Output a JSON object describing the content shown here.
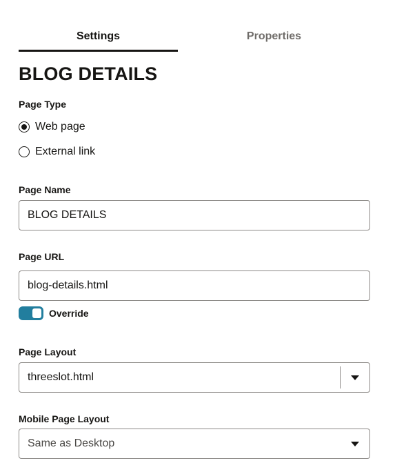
{
  "tabs": [
    {
      "label": "Settings",
      "active": true
    },
    {
      "label": "Properties",
      "active": false
    }
  ],
  "page_title": "BLOG DETAILS",
  "page_type": {
    "label": "Page Type",
    "options": [
      {
        "label": "Web page",
        "selected": true
      },
      {
        "label": "External link",
        "selected": false
      }
    ]
  },
  "page_name": {
    "label": "Page Name",
    "value": "BLOG DETAILS"
  },
  "page_url": {
    "label": "Page URL",
    "value": "blog-details.html",
    "override_label": "Override",
    "override_on": true
  },
  "page_layout": {
    "label": "Page Layout",
    "value": "threeslot.html"
  },
  "mobile_layout": {
    "label": "Mobile Page Layout",
    "value": "Same as Desktop"
  },
  "colors": {
    "toggle_on": "#227e9e",
    "text": "#161513",
    "inactive_tab": "#6f6c69",
    "border": "#8b8885"
  },
  "icons": {
    "radio_selected": "radio-selected-icon",
    "radio_unselected": "radio-unselected-icon",
    "dropdown": "chevron-down-icon"
  }
}
